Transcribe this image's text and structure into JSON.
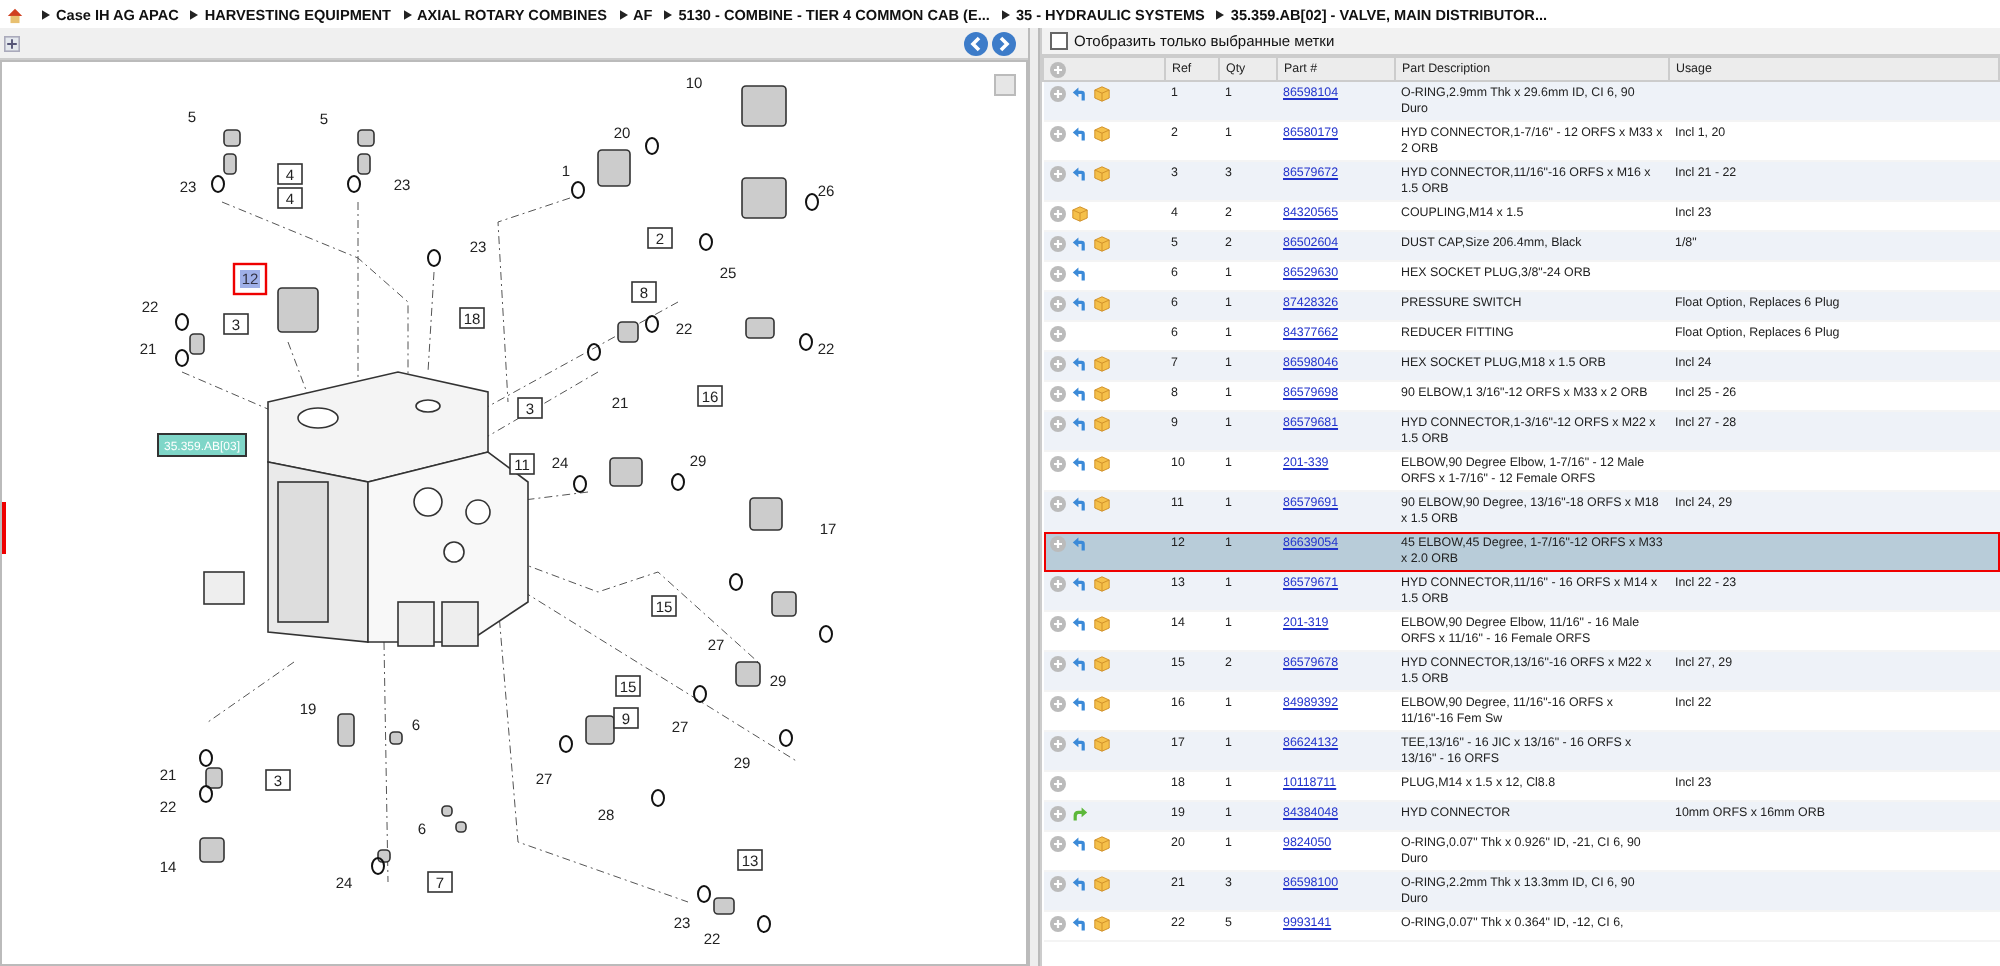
{
  "breadcrumb": [
    "Case IH AG APAC",
    "HARVESTING EQUIPMENT",
    "AXIAL ROTARY COMBINES",
    "AF",
    "5130 - COMBINE - TIER 4 COMMON CAB (E...",
    "35 - HYDRAULIC SYSTEMS",
    "35.359.AB[02] - VALVE, MAIN DISTRIBUTOR..."
  ],
  "diagram": {
    "sheet_label": "35.359.AB[03]",
    "callouts": [
      {
        "text": "10",
        "kind": "plain",
        "selected": false
      },
      {
        "text": "5",
        "kind": "plain",
        "selected": false
      },
      {
        "text": "5",
        "kind": "plain",
        "selected": false
      },
      {
        "text": "20",
        "kind": "plain",
        "selected": false
      },
      {
        "text": "1",
        "kind": "plain",
        "selected": false
      },
      {
        "text": "4",
        "kind": "boxed",
        "selected": false
      },
      {
        "text": "23",
        "kind": "plain",
        "selected": false
      },
      {
        "text": "23",
        "kind": "plain",
        "selected": false
      },
      {
        "text": "26",
        "kind": "plain",
        "selected": false
      },
      {
        "text": "4",
        "kind": "boxed",
        "selected": false
      },
      {
        "text": "2",
        "kind": "boxed",
        "selected": false
      },
      {
        "text": "23",
        "kind": "plain",
        "selected": false
      },
      {
        "text": "12",
        "kind": "plain",
        "selected": true
      },
      {
        "text": "25",
        "kind": "plain",
        "selected": false
      },
      {
        "text": "8",
        "kind": "boxed",
        "selected": false
      },
      {
        "text": "22",
        "kind": "plain",
        "selected": false
      },
      {
        "text": "18",
        "kind": "boxed",
        "selected": false
      },
      {
        "text": "3",
        "kind": "boxed",
        "selected": false
      },
      {
        "text": "22",
        "kind": "plain",
        "selected": false
      },
      {
        "text": "21",
        "kind": "plain",
        "selected": false
      },
      {
        "text": "22",
        "kind": "plain",
        "selected": false
      },
      {
        "text": "3",
        "kind": "boxed",
        "selected": false
      },
      {
        "text": "21",
        "kind": "plain",
        "selected": false
      },
      {
        "text": "16",
        "kind": "boxed",
        "selected": false
      },
      {
        "text": "11",
        "kind": "boxed",
        "selected": false
      },
      {
        "text": "24",
        "kind": "plain",
        "selected": false
      },
      {
        "text": "29",
        "kind": "plain",
        "selected": false
      },
      {
        "text": "17",
        "kind": "plain",
        "selected": false
      },
      {
        "text": "15",
        "kind": "boxed",
        "selected": false
      },
      {
        "text": "27",
        "kind": "plain",
        "selected": false
      },
      {
        "text": "29",
        "kind": "plain",
        "selected": false
      },
      {
        "text": "15",
        "kind": "boxed",
        "selected": false
      },
      {
        "text": "19",
        "kind": "plain",
        "selected": false
      },
      {
        "text": "9",
        "kind": "boxed",
        "selected": false
      },
      {
        "text": "6",
        "kind": "plain",
        "selected": false
      },
      {
        "text": "27",
        "kind": "plain",
        "selected": false
      },
      {
        "text": "29",
        "kind": "plain",
        "selected": false
      },
      {
        "text": "21",
        "kind": "plain",
        "selected": false
      },
      {
        "text": "3",
        "kind": "boxed",
        "selected": false
      },
      {
        "text": "27",
        "kind": "plain",
        "selected": false
      },
      {
        "text": "22",
        "kind": "plain",
        "selected": false
      },
      {
        "text": "28",
        "kind": "plain",
        "selected": false
      },
      {
        "text": "6",
        "kind": "plain",
        "selected": false
      },
      {
        "text": "13",
        "kind": "boxed",
        "selected": false
      },
      {
        "text": "14",
        "kind": "plain",
        "selected": false
      },
      {
        "text": "24",
        "kind": "plain",
        "selected": false
      },
      {
        "text": "7",
        "kind": "boxed",
        "selected": false
      },
      {
        "text": "23",
        "kind": "plain",
        "selected": false
      },
      {
        "text": "22",
        "kind": "plain",
        "selected": false
      }
    ]
  },
  "parts": {
    "filter": {
      "label": "Отобразить только выбранные метки",
      "checked": false
    },
    "columns": [
      "Ref",
      "Qty",
      "Part #",
      "Part Description",
      "Usage"
    ],
    "rows": [
      {
        "ref": "1",
        "qty": "1",
        "part": "86598104",
        "description": "O-RING,2.9mm Thk x 29.6mm ID, CI 6, 90 Duro",
        "usage": "",
        "icons": [
          {
            "kind": "add"
          },
          {
            "kind": "return"
          },
          {
            "kind": "package"
          }
        ],
        "selected": false
      },
      {
        "ref": "2",
        "qty": "1",
        "part": "86580179",
        "description": "HYD CONNECTOR,1-7/16\" - 12 ORFS x M33 x 2 ORB",
        "usage": "Incl 1, 20",
        "icons": [
          {
            "kind": "add"
          },
          {
            "kind": "return"
          },
          {
            "kind": "package"
          }
        ],
        "selected": false
      },
      {
        "ref": "3",
        "qty": "3",
        "part": "86579672",
        "description": "HYD CONNECTOR,11/16\"-16 ORFS x M16 x 1.5 ORB",
        "usage": "Incl 21 - 22",
        "icons": [
          {
            "kind": "add"
          },
          {
            "kind": "return"
          },
          {
            "kind": "package"
          }
        ],
        "selected": false
      },
      {
        "ref": "4",
        "qty": "2",
        "part": "84320565",
        "description": "COUPLING,M14 x 1.5",
        "usage": "Incl 23",
        "icons": [
          {
            "kind": "add"
          },
          {
            "kind": "package"
          }
        ],
        "selected": false
      },
      {
        "ref": "5",
        "qty": "2",
        "part": "86502604",
        "description": "DUST CAP,Size 206.4mm, Black",
        "usage": "1/8\"",
        "icons": [
          {
            "kind": "add"
          },
          {
            "kind": "return"
          },
          {
            "kind": "package"
          }
        ],
        "selected": false
      },
      {
        "ref": "6",
        "qty": "1",
        "part": "86529630",
        "description": "HEX SOCKET PLUG,3/8\"-24 ORB",
        "usage": "",
        "icons": [
          {
            "kind": "add"
          },
          {
            "kind": "return"
          }
        ],
        "selected": false
      },
      {
        "ref": "6",
        "qty": "1",
        "part": "87428326",
        "description": "PRESSURE SWITCH",
        "usage": "Float Option, Replaces 6 Plug",
        "icons": [
          {
            "kind": "add"
          },
          {
            "kind": "return"
          },
          {
            "kind": "package"
          }
        ],
        "selected": false
      },
      {
        "ref": "6",
        "qty": "1",
        "part": "84377662",
        "description": "REDUCER FITTING",
        "usage": "Float Option, Replaces 6 Plug",
        "icons": [
          {
            "kind": "add"
          }
        ],
        "selected": false
      },
      {
        "ref": "7",
        "qty": "1",
        "part": "86598046",
        "description": "HEX SOCKET PLUG,M18 x 1.5 ORB",
        "usage": "Incl 24",
        "icons": [
          {
            "kind": "add"
          },
          {
            "kind": "return"
          },
          {
            "kind": "package"
          }
        ],
        "selected": false
      },
      {
        "ref": "8",
        "qty": "1",
        "part": "86579698",
        "description": "90 ELBOW,1 3/16\"-12 ORFS x M33 x 2 ORB",
        "usage": "Incl 25 - 26",
        "icons": [
          {
            "kind": "add"
          },
          {
            "kind": "return"
          },
          {
            "kind": "package"
          }
        ],
        "selected": false
      },
      {
        "ref": "9",
        "qty": "1",
        "part": "86579681",
        "description": "HYD CONNECTOR,1-3/16\"-12 ORFS x M22 x 1.5 ORB",
        "usage": "Incl 27 - 28",
        "icons": [
          {
            "kind": "add"
          },
          {
            "kind": "return"
          },
          {
            "kind": "package"
          }
        ],
        "selected": false
      },
      {
        "ref": "10",
        "qty": "1",
        "part": "201-339",
        "description": "ELBOW,90 Degree Elbow, 1-7/16\" - 12 Male ORFS x 1-7/16\" - 12 Female ORFS",
        "usage": "",
        "icons": [
          {
            "kind": "add"
          },
          {
            "kind": "return"
          },
          {
            "kind": "package"
          }
        ],
        "selected": false
      },
      {
        "ref": "11",
        "qty": "1",
        "part": "86579691",
        "description": "90 ELBOW,90 Degree, 13/16\"-18 ORFS x M18 x 1.5 ORB",
        "usage": "Incl 24, 29",
        "icons": [
          {
            "kind": "add"
          },
          {
            "kind": "return"
          },
          {
            "kind": "package"
          }
        ],
        "selected": false
      },
      {
        "ref": "12",
        "qty": "1",
        "part": "86639054",
        "description": "45 ELBOW,45 Degree, 1-7/16\"-12 ORFS x M33 x 2.0 ORB",
        "usage": "",
        "icons": [
          {
            "kind": "add"
          },
          {
            "kind": "return"
          }
        ],
        "selected": true
      },
      {
        "ref": "13",
        "qty": "1",
        "part": "86579671",
        "description": "HYD CONNECTOR,11/16\" - 16 ORFS x M14 x 1.5 ORB",
        "usage": "Incl 22 - 23",
        "icons": [
          {
            "kind": "add"
          },
          {
            "kind": "return"
          },
          {
            "kind": "package"
          }
        ],
        "selected": false
      },
      {
        "ref": "14",
        "qty": "1",
        "part": "201-319",
        "description": "ELBOW,90 Degree Elbow, 11/16\" - 16 Male ORFS x 11/16\" - 16 Female ORFS",
        "usage": "",
        "icons": [
          {
            "kind": "add"
          },
          {
            "kind": "return"
          },
          {
            "kind": "package"
          }
        ],
        "selected": false
      },
      {
        "ref": "15",
        "qty": "2",
        "part": "86579678",
        "description": "HYD CONNECTOR,13/16\"-16 ORFS x M22 x 1.5 ORB",
        "usage": "Incl 27, 29",
        "icons": [
          {
            "kind": "add"
          },
          {
            "kind": "return"
          },
          {
            "kind": "package"
          }
        ],
        "selected": false
      },
      {
        "ref": "16",
        "qty": "1",
        "part": "84989392",
        "description": "ELBOW,90 Degree, 11/16\"-16 ORFS x 11/16\"-16 Fem Sw",
        "usage": "Incl 22",
        "icons": [
          {
            "kind": "add"
          },
          {
            "kind": "return"
          },
          {
            "kind": "package"
          }
        ],
        "selected": false
      },
      {
        "ref": "17",
        "qty": "1",
        "part": "86624132",
        "description": "TEE,13/16\" - 16 JIC x 13/16\" - 16 ORFS x 13/16\" - 16 ORFS",
        "usage": "",
        "icons": [
          {
            "kind": "add"
          },
          {
            "kind": "return"
          },
          {
            "kind": "package"
          }
        ],
        "selected": false
      },
      {
        "ref": "18",
        "qty": "1",
        "part": "10118711",
        "description": "PLUG,M14 x 1.5 x 12, Cl8.8",
        "usage": "Incl 23",
        "icons": [
          {
            "kind": "add"
          }
        ],
        "selected": false
      },
      {
        "ref": "19",
        "qty": "1",
        "part": "84384048",
        "description": "HYD CONNECTOR",
        "usage": "10mm ORFS x 16mm ORB",
        "icons": [
          {
            "kind": "add"
          },
          {
            "kind": "forward"
          }
        ],
        "selected": false
      },
      {
        "ref": "20",
        "qty": "1",
        "part": "9824050",
        "description": "O-RING,0.07\" Thk x 0.926\" ID, -21, CI 6, 90 Duro",
        "usage": "",
        "icons": [
          {
            "kind": "add"
          },
          {
            "kind": "return"
          },
          {
            "kind": "package"
          }
        ],
        "selected": false
      },
      {
        "ref": "21",
        "qty": "3",
        "part": "86598100",
        "description": "O-RING,2.2mm Thk x 13.3mm ID, CI 6, 90 Duro",
        "usage": "",
        "icons": [
          {
            "kind": "add"
          },
          {
            "kind": "return"
          },
          {
            "kind": "package"
          }
        ],
        "selected": false
      },
      {
        "ref": "22",
        "qty": "5",
        "part": "9993141",
        "description": "O-RING,0.07\" Thk x 0.364\" ID, -12, CI 6,",
        "usage": "",
        "icons": [
          {
            "kind": "add"
          },
          {
            "kind": "return"
          },
          {
            "kind": "package"
          }
        ],
        "selected": false
      }
    ]
  }
}
